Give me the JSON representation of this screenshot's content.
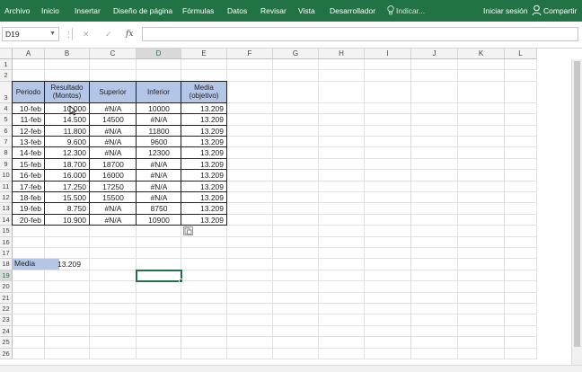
{
  "ribbon": {
    "tabs": [
      "Archivo",
      "Inicio",
      "Insertar",
      "Diseño de página",
      "Fórmulas",
      "Datos",
      "Revisar",
      "Vista",
      "Desarrollador"
    ],
    "tell_me": "Indicar...",
    "signin": "Iniciar sesión",
    "share": "Compartir"
  },
  "formula_bar": {
    "name_box": "D19",
    "fx": "fx",
    "cancel": "✕",
    "enter": "✓",
    "formula": ""
  },
  "columns": [
    "A",
    "B",
    "C",
    "D",
    "E",
    "F",
    "G",
    "H",
    "I",
    "J",
    "K",
    "L"
  ],
  "rows": [
    "1",
    "2",
    "3",
    "4",
    "5",
    "6",
    "7",
    "8",
    "9",
    "10",
    "11",
    "12",
    "13",
    "14",
    "15",
    "16",
    "17",
    "18",
    "19",
    "20",
    "21",
    "22",
    "23",
    "24",
    "25",
    "26"
  ],
  "table": {
    "headers": {
      "periodo": "Periodo",
      "resultado_1": "Resultado",
      "resultado_2": "(Montos)",
      "superior": "Superior",
      "inferior": "Inferior",
      "media_1": "Media",
      "media_2": "(objetivo)"
    },
    "rows": [
      [
        "10-feb",
        "10.000",
        "#N/A",
        "10000",
        "13.209"
      ],
      [
        "11-feb",
        "14.500",
        "14500",
        "#N/A",
        "13.209"
      ],
      [
        "12-feb",
        "11.800",
        "#N/A",
        "11800",
        "13.209"
      ],
      [
        "13-feb",
        "9.600",
        "#N/A",
        "9600",
        "13.209"
      ],
      [
        "14-feb",
        "12.300",
        "#N/A",
        "12300",
        "13.209"
      ],
      [
        "15-feb",
        "18.700",
        "18700",
        "#N/A",
        "13.209"
      ],
      [
        "16-feb",
        "16.000",
        "16000",
        "#N/A",
        "13.209"
      ],
      [
        "17-feb",
        "17.250",
        "17250",
        "#N/A",
        "13.209"
      ],
      [
        "18-feb",
        "15.500",
        "15500",
        "#N/A",
        "13.209"
      ],
      [
        "19-feb",
        "8.750",
        "#N/A",
        "8750",
        "13.209"
      ],
      [
        "20-feb",
        "10.900",
        "#N/A",
        "10900",
        "13.209"
      ]
    ]
  },
  "summary": {
    "label": "Media",
    "value": "13.209"
  },
  "colors": {
    "ribbon": "#217346",
    "header_fill": "#b4c6e7",
    "selection": "#217346"
  }
}
